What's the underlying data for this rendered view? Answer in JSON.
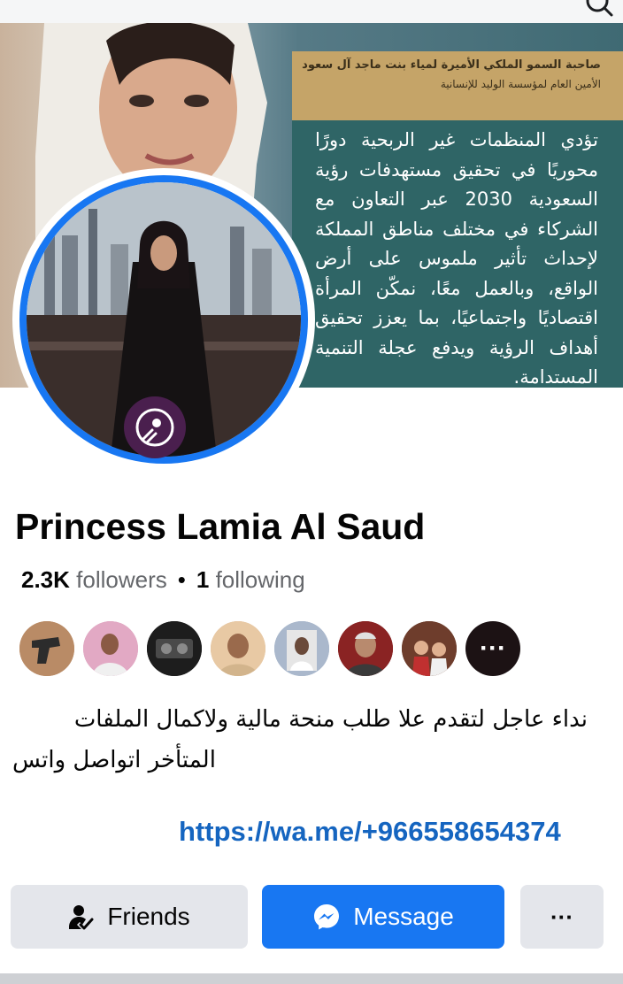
{
  "cover": {
    "header_line1": "صاحبة السمو الملكي الأميرة لمياء بنت ماجد آل سعود",
    "header_line2": "الأمين العام لمؤسسة الوليد للإنسانية",
    "quote": "تؤدي المنظمات غير الربحية دورًا محوريًا في تحقيق مستهدفات رؤية السعودية 2030 عبر التعاون مع الشركاء في مختلف مناطق المملكة لإحداث تأثير ملموس على أرض الواقع، وبالعمل معًا، نمكّن المرأة اقتصاديًا واجتماعيًا، بما يعزز تحقيق أهداف الرؤية ويدفع عجلة التنمية المستدامة."
  },
  "profile": {
    "name": "Princess Lamia Al Saud",
    "followers_count": "2.3K",
    "followers_label": "followers",
    "separator": "•",
    "following_count": "1",
    "following_label": "following",
    "more_friends": "···",
    "bio_line1": "نداء عاجل لتقدم علا طلب منحة مالية ولاكمال الملفات",
    "bio_line2": "المتأخر اتواصل واتس",
    "link": "https://wa.me/+966558654374"
  },
  "actions": {
    "friends_label": "Friends",
    "message_label": "Message",
    "more_label": "···"
  },
  "colors": {
    "accent": "#1877f2",
    "link": "#1565c0",
    "button_gray": "#e4e6eb"
  }
}
